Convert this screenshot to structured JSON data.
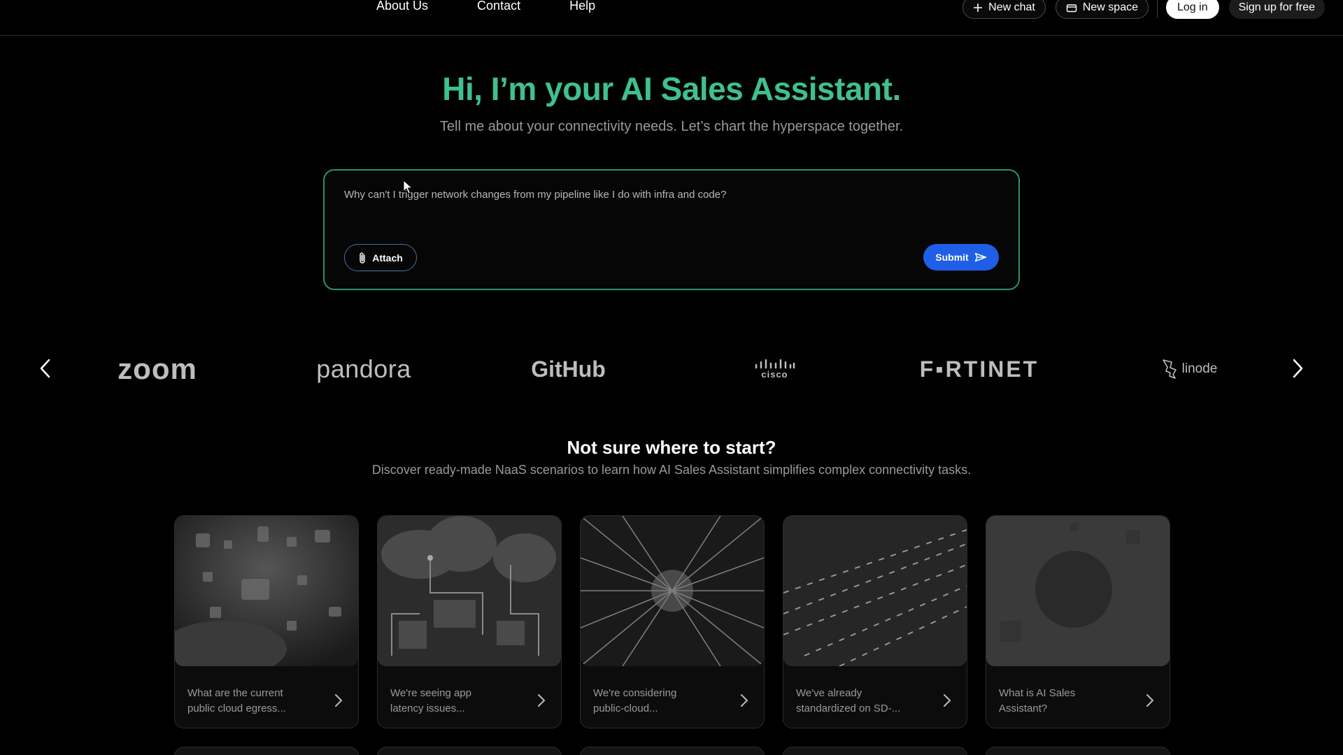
{
  "nav": {
    "links": [
      "About Us",
      "Contact",
      "Help"
    ],
    "new_chat": "New chat",
    "new_space": "New space",
    "login": "Log in",
    "signup": "Sign up for free"
  },
  "hero": {
    "title": "Hi, I’m your AI Sales Assistant.",
    "subtitle": "Tell me about your connectivity needs. Let’s chart the hyperspace together."
  },
  "prompt": {
    "value": "Why can't I trigger network changes from my pipeline like I do with infra and code?",
    "attach_label": "Attach",
    "submit_label": "Submit"
  },
  "logos": [
    "zoom",
    "pandora",
    "GitHub",
    "cisco",
    "F▪RTINET",
    "linode"
  ],
  "section": {
    "title": "Not sure where to start?",
    "subtitle": "Discover ready-made NaaS scenarios to learn how AI Sales Assistant simplifies complex connectivity tasks."
  },
  "cards": [
    {
      "line1": "What are the current",
      "line2": "public cloud egress..."
    },
    {
      "line1": "We're seeing app",
      "line2": "latency issues..."
    },
    {
      "line1": "We're considering",
      "line2": "public-cloud..."
    },
    {
      "line1": "We've already",
      "line2": "standardized on SD-..."
    },
    {
      "line1": "What is AI Sales",
      "line2": "Assistant?"
    }
  ],
  "colors": {
    "accent_green": "#3fc08f",
    "submit_blue": "#1f5fe8",
    "border_green": "#2f8f6f"
  }
}
